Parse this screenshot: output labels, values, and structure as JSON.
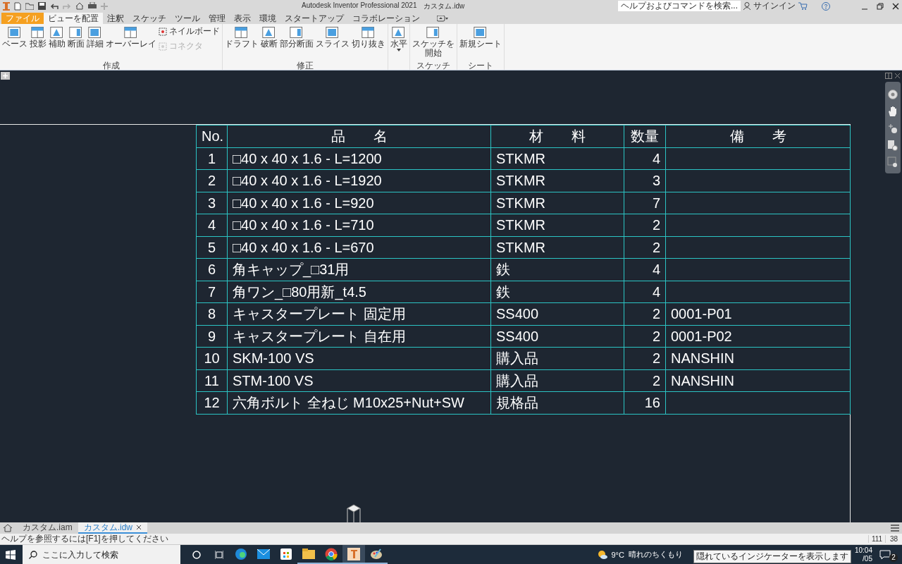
{
  "title_bar": {
    "app_title": "Autodesk Inventor Professional 2021",
    "document": "カスタム.idw",
    "search": {
      "placeholder": "ヘルプおよびコマンドを検索..."
    },
    "sign_in": "サインイン"
  },
  "ribbon_tabs": [
    {
      "label": "ファイル",
      "kind": "file",
      "selected": false
    },
    {
      "label": "ビューを配置",
      "kind": "tab",
      "selected": true
    },
    {
      "label": "注釈",
      "kind": "tab",
      "selected": false
    },
    {
      "label": "スケッチ",
      "kind": "tab",
      "selected": false
    },
    {
      "label": "ツール",
      "kind": "tab",
      "selected": false
    },
    {
      "label": "管理",
      "kind": "tab",
      "selected": false
    },
    {
      "label": "表示",
      "kind": "tab",
      "selected": false
    },
    {
      "label": "環境",
      "kind": "tab",
      "selected": false
    },
    {
      "label": "スタートアップ",
      "kind": "tab",
      "selected": false
    },
    {
      "label": "コラボレーション",
      "kind": "tab",
      "selected": false
    }
  ],
  "ribbon_groups": [
    {
      "label": "作成",
      "items": [
        {
          "label": "ベース",
          "kind": "large",
          "disabled": false
        },
        {
          "label": "投影",
          "kind": "large",
          "disabled": false
        },
        {
          "label": "補助",
          "kind": "large",
          "disabled": false
        },
        {
          "label": "断面",
          "kind": "large",
          "disabled": false
        },
        {
          "label": "詳細",
          "kind": "large",
          "disabled": false
        },
        {
          "label": "オーバーレイ",
          "kind": "large",
          "disabled": false
        },
        {
          "label": "ネイルボード",
          "kind": "small",
          "disabled": false
        },
        {
          "label": "コネクタ",
          "kind": "small",
          "disabled": true
        }
      ]
    },
    {
      "label": "修正",
      "items": [
        {
          "label": "ドラフト",
          "kind": "large",
          "disabled": false
        },
        {
          "label": "破断",
          "kind": "large",
          "disabled": false
        },
        {
          "label": "部分断面",
          "kind": "large",
          "disabled": false
        },
        {
          "label": "スライス",
          "kind": "large",
          "disabled": false
        },
        {
          "label": "切り抜き",
          "kind": "large",
          "disabled": false
        }
      ]
    },
    {
      "items": [
        {
          "label": "水平",
          "kind": "dropdown",
          "disabled": false
        }
      ]
    },
    {
      "label": "スケッチ",
      "items": [
        {
          "label": "スケッチを開始",
          "kind": "large",
          "disabled": false
        }
      ]
    },
    {
      "label": "シート",
      "items": [
        {
          "label": "新規シート",
          "kind": "large",
          "disabled": false
        }
      ]
    }
  ],
  "bom_table": {
    "columns": [
      "No.",
      "品　　名",
      "材　　料",
      "数量",
      "備　　考"
    ],
    "rows": [
      {
        "no": "1",
        "name": "□40 x 40 x 1.6 - L=1200",
        "material": "STKMR",
        "qty": "4"
      },
      {
        "no": "2",
        "name": "□40 x 40 x 1.6 - L=1920",
        "material": "STKMR",
        "qty": "3"
      },
      {
        "no": "3",
        "name": "□40 x 40 x 1.6 - L=920",
        "material": "STKMR",
        "qty": "7"
      },
      {
        "no": "4",
        "name": "□40 x 40 x 1.6 - L=710",
        "material": "STKMR",
        "qty": "2"
      },
      {
        "no": "5",
        "name": "□40 x 40 x 1.6 - L=670",
        "material": "STKMR",
        "qty": "2"
      },
      {
        "no": "6",
        "name": "角キャップ_□31用",
        "material": "鉄",
        "qty": "4"
      },
      {
        "no": "7",
        "name": "角ワン_□80用新_t4.5",
        "material": "鉄",
        "qty": "4"
      },
      {
        "no": "8",
        "name": "キャスタープレート 固定用",
        "material": "SS400",
        "qty": "2",
        "remarks": "0001-P01"
      },
      {
        "no": "9",
        "name": "キャスタープレート 自在用",
        "material": "SS400",
        "qty": "2",
        "remarks": "0001-P02"
      },
      {
        "no": "10",
        "name": "SKM-100 VS",
        "material": "購入品",
        "qty": "2",
        "remarks": "NANSHIN"
      },
      {
        "no": "11",
        "name": "STM-100 VS",
        "material": "購入品",
        "qty": "2",
        "remarks": "NANSHIN"
      },
      {
        "no": "12",
        "name": "六角ボルト 全ねじ M10x25+Nut+SW",
        "material": "規格品",
        "qty": "16"
      }
    ]
  },
  "doc_tabs": [
    {
      "label": "カスタム.iam",
      "selected": false
    },
    {
      "label": "カスタム.idw",
      "selected": true
    }
  ],
  "status_bar": {
    "help": "ヘルプを参照するには[F1]を押してください",
    "cells": [
      "111",
      "38"
    ]
  },
  "taskbar": {
    "search": {
      "placeholder": "ここに入力して検索"
    },
    "apps": [
      {
        "kind": "edge",
        "running": false,
        "selected": false
      },
      {
        "kind": "mail",
        "running": false,
        "selected": false
      },
      {
        "kind": "store",
        "running": false,
        "selected": false
      },
      {
        "kind": "folder",
        "running": true,
        "selected": false
      },
      {
        "kind": "chrome",
        "running": true,
        "selected": false
      },
      {
        "kind": "inventor",
        "running": true,
        "selected": true
      },
      {
        "kind": "paint",
        "running": true,
        "selected": false
      }
    ],
    "weather": {
      "temp": "9°C",
      "text": "晴れのちくもり"
    },
    "time": "10:04",
    "date": "/05",
    "notifications": "2",
    "tooltip": "隠れているインジケーターを表示します"
  }
}
